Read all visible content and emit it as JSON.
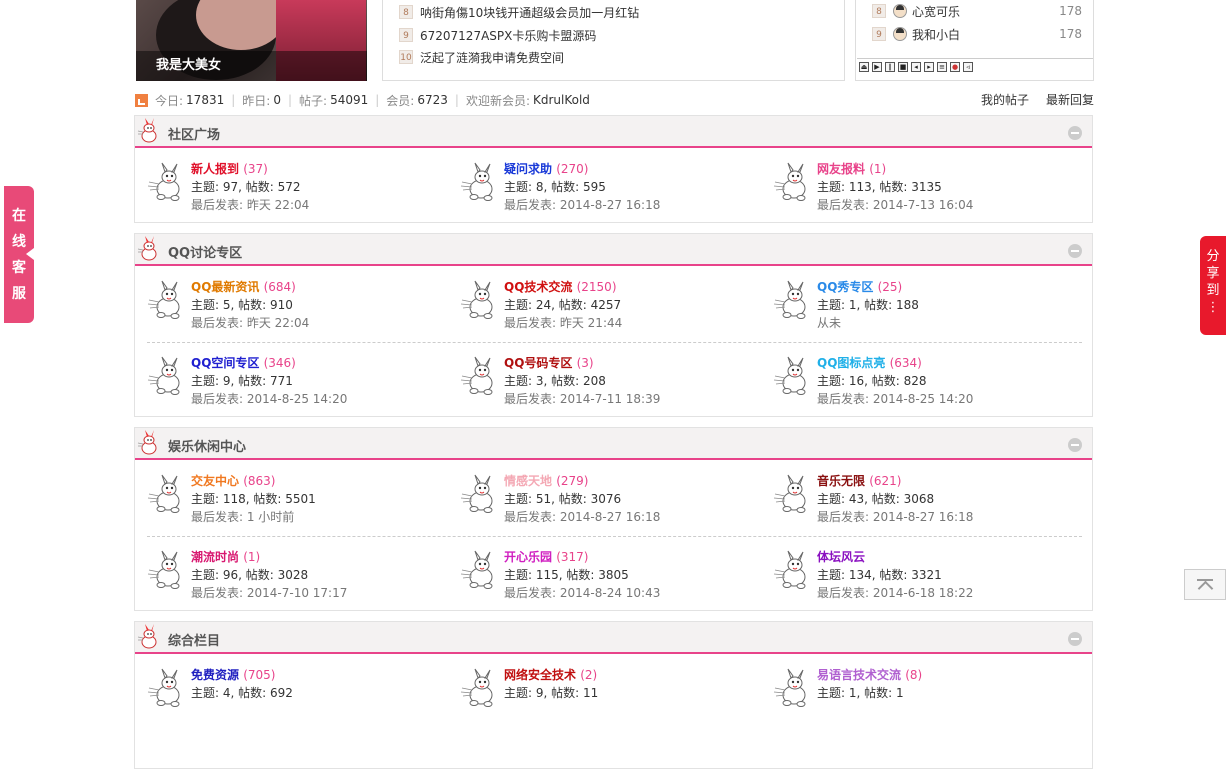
{
  "top": {
    "photo_caption": "我是大美女",
    "hot_list": [
      {
        "num": "8",
        "text": "呐街角傷10块钱开通超级会员加一月红钻"
      },
      {
        "num": "9",
        "text": "67207127ASPX卡乐购卡盟源码"
      },
      {
        "num": "10",
        "text": "泛起了涟漪我申请免费空间"
      }
    ],
    "rank_list": [
      {
        "num": "8",
        "name": "心宽可乐",
        "score": "178"
      },
      {
        "num": "9",
        "name": "我和小白",
        "score": "178"
      }
    ]
  },
  "stats": {
    "today_label": "今日:",
    "today": "17831",
    "yesterday_label": "昨日:",
    "yesterday": "0",
    "posts_label": "帖子:",
    "posts": "54091",
    "members_label": "会员:",
    "members": "6723",
    "welcome_label": "欢迎新会员:",
    "newest": "KdrulKold",
    "my_posts": "我的帖子",
    "latest_reply": "最新回复"
  },
  "categories": [
    {
      "title": "社区广场",
      "forums": [
        {
          "name": "新人报到",
          "count": "(37)",
          "color": "#e0102a",
          "stat": "主题: 97, 帖数: 572",
          "last": "最后发表: 昨天 22:04"
        },
        {
          "name": "疑问求助",
          "count": "(270)",
          "color": "#1a3ad8",
          "stat": "主题: 8, 帖数: 595",
          "last": "最后发表: 2014-8-27 16:18"
        },
        {
          "name": "网友报料",
          "count": "(1)",
          "color": "#e8438a",
          "stat": "主题: 113, 帖数: 3135",
          "last": "最后发表: 2014-7-13 16:04"
        }
      ]
    },
    {
      "title": "QQ讨论专区",
      "forums": [
        {
          "name": "QQ最新资讯",
          "count": "(684)",
          "color": "#e07a00",
          "stat": "主题: 5, 帖数: 910",
          "last": "最后发表: 昨天 22:04"
        },
        {
          "name": "QQ技术交流",
          "count": "(2150)",
          "color": "#d01010",
          "stat": "主题: 24, 帖数: 4257",
          "last": "最后发表: 昨天 21:44"
        },
        {
          "name": "QQ秀专区",
          "count": "(25)",
          "color": "#2a8ae8",
          "stat": "主题: 1, 帖数: 188",
          "last": "从未"
        },
        {
          "name": "QQ空间专区",
          "count": "(346)",
          "color": "#2020d0",
          "stat": "主题: 9, 帖数: 771",
          "last": "最后发表: 2014-8-25 14:20"
        },
        {
          "name": "QQ号码专区",
          "count": "(3)",
          "color": "#b01010",
          "stat": "主题: 3, 帖数: 208",
          "last": "最后发表: 2014-7-11 18:39"
        },
        {
          "name": "QQ图标点亮",
          "count": "(634)",
          "color": "#20b0e8",
          "stat": "主题: 16, 帖数: 828",
          "last": "最后发表: 2014-8-25 14:20"
        }
      ]
    },
    {
      "title": "娱乐休闲中心",
      "forums": [
        {
          "name": "交友中心",
          "count": "(863)",
          "color": "#f07820",
          "stat": "主题: 118, 帖数: 5501",
          "last": "最后发表: 1 小时前"
        },
        {
          "name": "情感天地",
          "count": "(279)",
          "color": "#f4a8b4",
          "stat": "主题: 51, 帖数: 3076",
          "last": "最后发表: 2014-8-27 16:18"
        },
        {
          "name": "音乐无限",
          "count": "(621)",
          "color": "#8a1010",
          "stat": "主题: 43, 帖数: 3068",
          "last": "最后发表: 2014-8-27 16:18"
        },
        {
          "name": "潮流时尚",
          "count": "(1)",
          "color": "#d81870",
          "stat": "主题: 96, 帖数: 3028",
          "last": "最后发表: 2014-7-10 17:17"
        },
        {
          "name": "开心乐园",
          "count": "(317)",
          "color": "#d020c0",
          "stat": "主题: 115, 帖数: 3805",
          "last": "最后发表: 2014-8-24 10:43"
        },
        {
          "name": "体坛风云",
          "count": "",
          "color": "#8a10c0",
          "stat": "主题: 134, 帖数: 3321",
          "last": "最后发表: 2014-6-18 18:22"
        }
      ]
    },
    {
      "title": "综合栏目",
      "forums": [
        {
          "name": "免费资源",
          "count": "(705)",
          "color": "#2020c0",
          "stat": "主题: 4, 帖数: 692",
          "last": ""
        },
        {
          "name": "网络安全技术",
          "count": "(2)",
          "color": "#c01010",
          "stat": "主题: 9, 帖数: 11",
          "last": ""
        },
        {
          "name": "易语言技术交流",
          "count": "(8)",
          "color": "#b060d0",
          "stat": "主题: 1, 帖数: 1",
          "last": ""
        }
      ]
    }
  ],
  "side": {
    "left_tab": [
      "在",
      "线",
      "客",
      "服"
    ],
    "right_tab": [
      "分",
      "享",
      "到",
      "⋮"
    ]
  },
  "icons": {
    "forum_icon": "bunny-icon",
    "collapse": "collapse-icon",
    "stats": "chart-icon",
    "back_to_top": "back-to-top-icon"
  },
  "colors": {
    "accent": "#e8438a",
    "share": "#e8192c"
  }
}
